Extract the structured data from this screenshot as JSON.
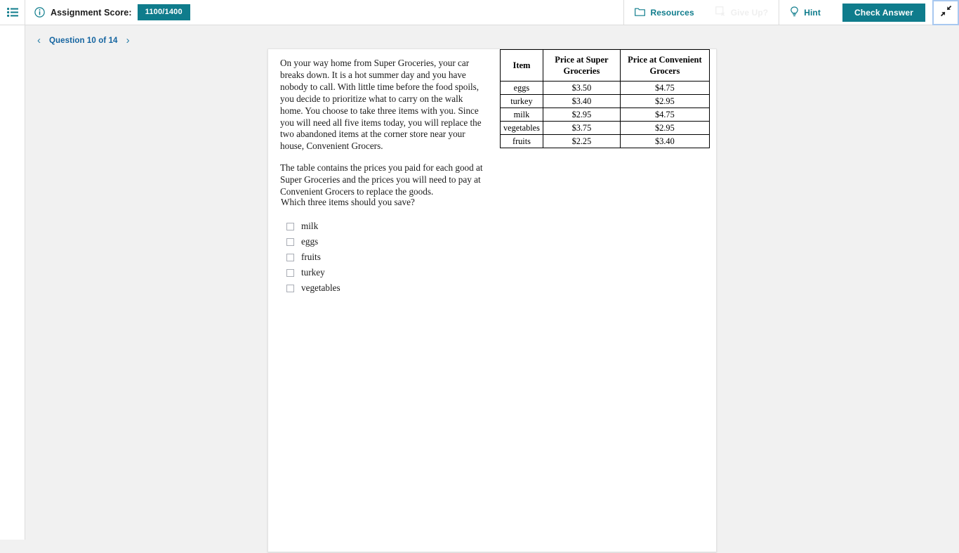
{
  "topbar": {
    "menu_icon": "hamburger-list-icon",
    "info_icon": "info-circle-icon",
    "score_label": "Assignment Score:",
    "score_value": "1100/1400",
    "resources_label": "Resources",
    "resources_icon": "folder-icon",
    "giveup_label": "Give Up?",
    "giveup_icon": "square-x-icon",
    "hint_label": "Hint",
    "hint_icon": "lightbulb-icon",
    "check_answer_label": "Check Answer",
    "collapse_icon": "collapse-arrows-icon",
    "accent_color": "#0f7c8c",
    "link_color": "#1464a0",
    "disabled_color": "#efefef"
  },
  "question_nav": {
    "prev_icon": "chevron-left-icon",
    "next_icon": "chevron-right-icon",
    "label": "Question 10 of 14"
  },
  "prompt": {
    "paragraph_1": "On your way home from Super Groceries, your car breaks down. It is a hot summer day and you have nobody to call. With little time before the food spoils, you decide to prioritize what to carry on the walk home. You choose to take three items with you. Since you will need all five items today, you will replace the two abandoned items at the corner store near your house, Convenient Grocers.",
    "paragraph_2": "The table contains the prices you paid for each good at Super Groceries and the prices you will need to pay at Convenient Grocers to replace the goods."
  },
  "price_table": {
    "headers": [
      "Item",
      "Price at Super Groceries",
      "Price at Convenient Grocers"
    ],
    "rows": [
      {
        "item": "eggs",
        "super": "$3.50",
        "convenient": "$4.75"
      },
      {
        "item": "turkey",
        "super": "$3.40",
        "convenient": "$2.95"
      },
      {
        "item": "milk",
        "super": "$2.95",
        "convenient": "$4.75"
      },
      {
        "item": "vegetables",
        "super": "$3.75",
        "convenient": "$2.95"
      },
      {
        "item": "fruits",
        "super": "$2.25",
        "convenient": "$3.40"
      }
    ]
  },
  "question": {
    "text": "Which three items should you save?",
    "choices": [
      {
        "label": "milk",
        "checked": false
      },
      {
        "label": "eggs",
        "checked": false
      },
      {
        "label": "fruits",
        "checked": false
      },
      {
        "label": "turkey",
        "checked": false
      },
      {
        "label": "vegetables",
        "checked": false
      }
    ]
  }
}
